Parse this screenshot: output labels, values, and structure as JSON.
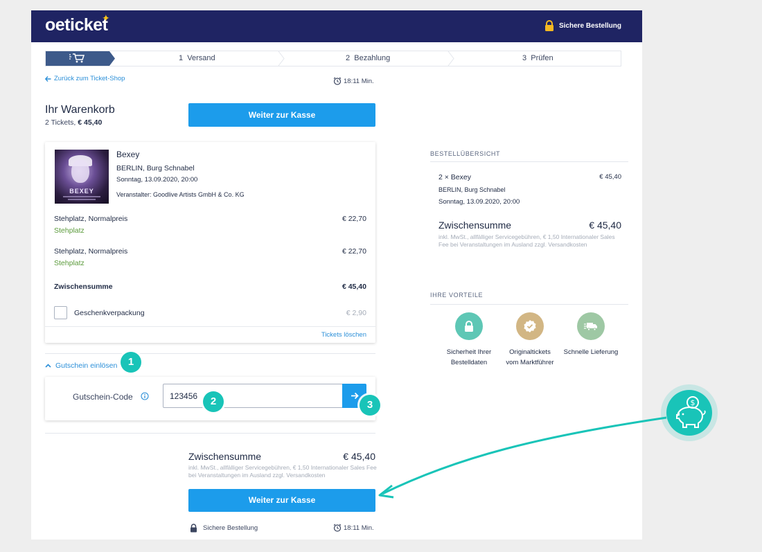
{
  "header": {
    "logo": "oeticket",
    "secure_label": "Sichere Bestellung"
  },
  "stepper": {
    "steps": [
      {
        "number": "1",
        "label": "Versand"
      },
      {
        "number": "2",
        "label": "Bezahlung"
      },
      {
        "number": "3",
        "label": "Prüfen"
      }
    ]
  },
  "nav": {
    "back_label": "Zurück zum Ticket-Shop",
    "timer": "18:11 Min."
  },
  "cart": {
    "title": "Ihr Warenkorb",
    "summary_prefix": "2 Tickets,",
    "summary_total": "€ 45,40",
    "checkout_label": "Weiter zur Kasse"
  },
  "event": {
    "image_title": "BEXEY",
    "name": "Bexey",
    "venue": "BERLIN, Burg Schnabel",
    "date": "Sonntag, 13.09.2020, 20:00",
    "organizer": "Veranstalter: Goodlive Artists GmbH & Co. KG"
  },
  "tickets": [
    {
      "label": "Stehplatz, Normalpreis",
      "category": "Stehplatz",
      "price": "€ 22,70"
    },
    {
      "label": "Stehplatz, Normalpreis",
      "category": "Stehplatz",
      "price": "€ 22,70"
    }
  ],
  "card": {
    "subtotal_label": "Zwischensumme",
    "subtotal_value": "€ 45,40",
    "gift_label": "Geschenkverpackung",
    "gift_price": "€ 2,90",
    "delete_label": "Tickets löschen"
  },
  "voucher": {
    "toggle_label": "Gutschein einlösen",
    "field_label": "Gutschein-Code",
    "value": "123456"
  },
  "bottom": {
    "subtotal_label": "Zwischensumme",
    "subtotal_value": "€ 45,40",
    "note": "inkl. MwSt., allfälliger Servicegebühren, € 1,50 Internationaler Sales Fee bei Veranstaltungen im Ausland zzgl. Versandkosten",
    "checkout_label": "Weiter zur Kasse",
    "secure_label": "Sichere Bestellung",
    "timer": "18:11 Min."
  },
  "summary": {
    "heading": "BESTELLÜBERSICHT",
    "item": "2 × Bexey",
    "item_price": "€ 45,40",
    "venue": "BERLIN, Burg Schnabel",
    "date": "Sonntag, 13.09.2020, 20:00",
    "subtotal_label": "Zwischensumme",
    "subtotal_value": "€ 45,40",
    "note": "inkl. MwSt., allfälliger Servicegebühren, € 1,50 Internationaler Sales Fee bei Veranstaltungen im Ausland zzgl. Versandkosten"
  },
  "benefits": {
    "heading": "IHRE VORTEILE",
    "items": [
      {
        "line1": "Sicherheit Ihrer",
        "line2": "Bestelldaten",
        "icon": "lock-icon",
        "color": "#5ec7b5"
      },
      {
        "line1": "Originaltickets",
        "line2": "vom Marktführer",
        "icon": "badge-check-icon",
        "color": "#d2b684"
      },
      {
        "line1": "Schnelle Lieferung",
        "line2": "",
        "icon": "truck-icon",
        "color": "#9ec8a4"
      }
    ]
  },
  "annotations": {
    "badges": [
      "1",
      "2",
      "3"
    ],
    "accent_color": "#19c4b8"
  },
  "colors": {
    "header_bg": "#1f2463",
    "primary_button": "#1c9ceb",
    "link": "#2b8fd8",
    "category_green": "#5a9a3a"
  }
}
